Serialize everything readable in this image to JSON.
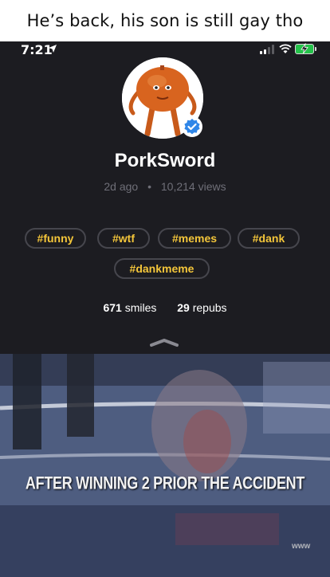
{
  "caption": "He’s back, his son is still gay tho",
  "status_bar": {
    "time": "7:21",
    "icons": [
      "location-arrow-icon",
      "signal-icon",
      "wifi-icon",
      "battery-charging-icon"
    ],
    "battery_color": "#24c24a"
  },
  "profile": {
    "username": "PorkSword",
    "posted": "2d ago",
    "separator": "•",
    "views": "10,214 views",
    "verified": true
  },
  "tags": [
    "#funny",
    "#wtf",
    "#memes",
    "#dank",
    "#dankmeme"
  ],
  "stats": {
    "smiles_count": "671",
    "smiles_label": "smiles",
    "repubs_count": "29",
    "repubs_label": "repubs"
  },
  "video": {
    "caption": "AFTER WINNING 2 PRIOR THE ACCIDENT",
    "watermark": "www"
  },
  "colors": {
    "background": "#1c1c21",
    "tag_text": "#f4c63a",
    "tag_border": "#46464d",
    "meta_text": "#6f6f78",
    "verified_blue": "#2f86e8"
  }
}
